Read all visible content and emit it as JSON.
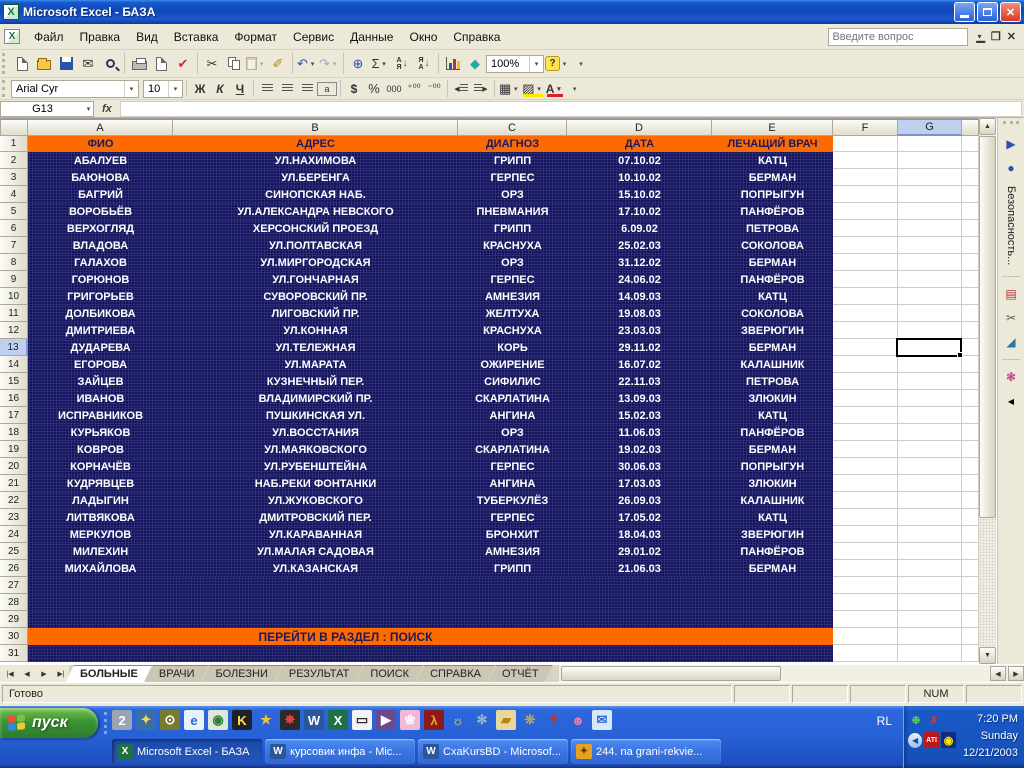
{
  "window": {
    "title": "Microsoft Excel - БАЗА"
  },
  "menu": {
    "items": [
      "Файл",
      "Правка",
      "Вид",
      "Вставка",
      "Формат",
      "Сервис",
      "Данные",
      "Окно",
      "Справка"
    ],
    "question_placeholder": "Введите вопрос"
  },
  "toolbars": {
    "standard": {
      "zoom": "100%"
    },
    "formatting": {
      "font": "Arial Cyr",
      "size": "10",
      "bold": "Ж",
      "italic": "К",
      "underline": "Ч",
      "currency": "$",
      "percent": "%",
      "thousands": "000"
    }
  },
  "formula_bar": {
    "name_box": "G13",
    "fx": "fx"
  },
  "sheet": {
    "columns": [
      "A",
      "B",
      "C",
      "D",
      "E",
      "F",
      "G"
    ],
    "selection": {
      "col": "G",
      "row": 13,
      "cell": "G13"
    },
    "rows_visible": 31,
    "header_row": {
      "cells": [
        "ФИО",
        "АДРЕС",
        "ДИАГНОЗ",
        "ДАТА",
        "ЛЕЧАЩИЙ ВРАЧ"
      ]
    },
    "records": [
      [
        "АБАЛУЕВ",
        "УЛ.НАХИМОВА",
        "ГРИПП",
        "07.10.02",
        "КАТЦ"
      ],
      [
        "БАЮНОВА",
        "УЛ.БЕРЕНГА",
        "ГЕРПЕС",
        "10.10.02",
        "БЕРМАН"
      ],
      [
        "БАГРИЙ",
        "СИНОПСКАЯ НАБ.",
        "ОРЗ",
        "15.10.02",
        "ПОПРЫГУН"
      ],
      [
        "ВОРОБЬЁВ",
        "УЛ.АЛЕКСАНДРА НЕВСКОГО",
        "ПНЕВМАНИЯ",
        "17.10.02",
        "ПАНФЁРОВ"
      ],
      [
        "ВЕРХОГЛЯД",
        "ХЕРСОНСКИЙ ПРОЕЗД",
        "ГРИПП",
        "6.09.02",
        "ПЕТРОВА"
      ],
      [
        "ВЛАДОВА",
        "УЛ.ПОЛТАВСКАЯ",
        "КРАСНУХА",
        "25.02.03",
        "СОКОЛОВА"
      ],
      [
        "ГАЛАХОВ",
        "УЛ.МИРГОРОДСКАЯ",
        "ОРЗ",
        "31.12.02",
        "БЕРМАН"
      ],
      [
        "ГОРЮНОВ",
        "УЛ.ГОНЧАРНАЯ",
        "ГЕРПЕС",
        "24.06.02",
        "ПАНФЁРОВ"
      ],
      [
        "ГРИГОРЬЕВ",
        "СУВОРОВСКИЙ ПР.",
        "АМНЕЗИЯ",
        "14.09.03",
        "КАТЦ"
      ],
      [
        "ДОЛБИКОВА",
        "ЛИГОВСКИЙ ПР.",
        "ЖЕЛТУХА",
        "19.08.03",
        "СОКОЛОВА"
      ],
      [
        "ДМИТРИЕВА",
        "УЛ.КОННАЯ",
        "КРАСНУХА",
        "23.03.03",
        "ЗВЕРЮГИН"
      ],
      [
        "ДУДАРЕВА",
        "УЛ.ТЕЛЕЖНАЯ",
        "КОРЬ",
        "29.11.02",
        "БЕРМАН"
      ],
      [
        "ЕГОРОВА",
        "УЛ.МАРАТА",
        "ОЖИРЕНИЕ",
        "16.07.02",
        "КАЛАШНИК"
      ],
      [
        "ЗАЙЦЕВ",
        "КУЗНЕЧНЫЙ ПЕР.",
        "СИФИЛИС",
        "22.11.03",
        "ПЕТРОВА"
      ],
      [
        "ИВАНОВ",
        "ВЛАДИМИРСКИЙ ПР.",
        "СКАРЛАТИНА",
        "13.09.03",
        "ЗЛЮКИН"
      ],
      [
        "ИСПРАВНИКОВ",
        "ПУШКИНСКАЯ УЛ.",
        "АНГИНА",
        "15.02.03",
        "КАТЦ"
      ],
      [
        "КУРЬЯКОВ",
        "УЛ.ВОССТАНИЯ",
        "ОРЗ",
        "11.06.03",
        "ПАНФЁРОВ"
      ],
      [
        "КОВРОВ",
        "УЛ.МАЯКОВСКОГО",
        "СКАРЛАТИНА",
        "19.02.03",
        "БЕРМАН"
      ],
      [
        "КОРНАЧЁВ",
        "УЛ.РУБЕНШТЕЙНА",
        "ГЕРПЕС",
        "30.06.03",
        "ПОПРЫГУН"
      ],
      [
        "КУДРЯВЦЕВ",
        "НАБ.РЕКИ ФОНТАНКИ",
        "АНГИНА",
        "17.03.03",
        "ЗЛЮКИН"
      ],
      [
        "ЛАДЫГИН",
        "УЛ.ЖУКОВСКОГО",
        "ТУБЕРКУЛЁЗ",
        "26.09.03",
        "КАЛАШНИК"
      ],
      [
        "ЛИТВЯКОВА",
        "ДМИТРОВСКИЙ ПЕР.",
        "ГЕРПЕС",
        "17.05.02",
        "КАТЦ"
      ],
      [
        "МЕРКУЛОВ",
        "УЛ.КАРАВАННАЯ",
        "БРОНХИТ",
        "18.04.03",
        "ЗВЕРЮГИН"
      ],
      [
        "МИЛЕХИН",
        "УЛ.МАЛАЯ САДОВАЯ",
        "АМНЕЗИЯ",
        "29.01.02",
        "ПАНФЁРОВ"
      ],
      [
        "МИХАЙЛОВА",
        "УЛ.КАЗАНСКАЯ",
        "ГРИПП",
        "21.06.03",
        "БЕРМАН"
      ]
    ],
    "banner_row": {
      "row": 30,
      "text": "ПЕРЕЙТИ В РАЗДЕЛ : ПОИСК"
    },
    "colors": {
      "header_bg": "#FF6A00",
      "table_bg": "#15155E",
      "table_text": "#FFFFFF"
    }
  },
  "security_toolbar": {
    "label": "Безопасность..."
  },
  "tabs": {
    "active": "БОЛЬНЫЕ",
    "items": [
      "БОЛЬНЫЕ",
      "ВРАЧИ",
      "БОЛЕЗНИ",
      "РЕЗУЛЬТАТ",
      "ПОИСК",
      "СПРАВКА",
      "ОТЧЁТ"
    ]
  },
  "status_bar": {
    "ready": "Готово",
    "num": "NUM"
  },
  "taskbar": {
    "start": "пуск",
    "quick_launch": [
      {
        "name": "user2-icon",
        "glyph": "2",
        "bg": "#9AA4B2",
        "fg": "#ffffff"
      },
      {
        "name": "winamp-icon",
        "glyph": "✦",
        "bg": "#3A6EA5",
        "fg": "#FFD34D"
      },
      {
        "name": "clock-app-icon",
        "glyph": "⊙",
        "bg": "#7A7A2E",
        "fg": "#ffffff"
      },
      {
        "name": "ie-icon",
        "glyph": "e",
        "bg": "#E8F0FA",
        "fg": "#2A6AD4"
      },
      {
        "name": "reget-icon",
        "glyph": "◉",
        "bg": "#DCE8DC",
        "fg": "#2E7D32"
      },
      {
        "name": "kazaa-icon",
        "glyph": "K",
        "bg": "#20202A",
        "fg": "#FFE34D"
      },
      {
        "name": "star-icon",
        "glyph": "★",
        "bg": "transparent",
        "fg": "#F4C430"
      },
      {
        "name": "nero-icon",
        "glyph": "✸",
        "bg": "#2A2A2A",
        "fg": "#E04040"
      },
      {
        "name": "word-icon",
        "glyph": "W",
        "bg": "#2B579A",
        "fg": "#ffffff"
      },
      {
        "name": "excel-icon",
        "glyph": "X",
        "bg": "#1E7145",
        "fg": "#ffffff"
      },
      {
        "name": "console-icon",
        "glyph": "▭",
        "bg": "#F4F4F4",
        "fg": "#2A2A2A"
      },
      {
        "name": "movie-icon",
        "glyph": "▶",
        "bg": "#6A4A8C",
        "fg": "#ffffff"
      },
      {
        "name": "photo-icon",
        "glyph": "❀",
        "bg": "#F2B8D8",
        "fg": "#ffffff"
      },
      {
        "name": "halflife-icon",
        "glyph": "λ",
        "bg": "#8C1A1A",
        "fg": "#F4A020"
      },
      {
        "name": "bulb-icon",
        "glyph": "☼",
        "bg": "transparent",
        "fg": "#FFE34D"
      },
      {
        "name": "storm-icon",
        "glyph": "✻",
        "bg": "transparent",
        "fg": "#9AB4D0"
      },
      {
        "name": "folder-app-icon",
        "glyph": "▰",
        "bg": "#E8D8A0",
        "fg": "#B8860B"
      },
      {
        "name": "paw-icon",
        "glyph": "❊",
        "bg": "transparent",
        "fg": "#C8B040"
      },
      {
        "name": "red-cross-icon",
        "glyph": "✝",
        "bg": "transparent",
        "fg": "#C03030"
      },
      {
        "name": "people-icon",
        "glyph": "☻",
        "bg": "transparent",
        "fg": "#E87AA0"
      },
      {
        "name": "outlook-icon",
        "glyph": "✉",
        "bg": "#D8E8F8",
        "fg": "#2A6AD4"
      }
    ],
    "buttons": [
      {
        "label": "Microsoft Excel - БАЗА",
        "icon": "excel",
        "active": true
      },
      {
        "label": "курсовик инфа - Mic...",
        "icon": "word",
        "active": false
      },
      {
        "label": "CxaKursBD - Microsof...",
        "icon": "word",
        "active": false
      },
      {
        "label": "244. na grani-rekvie...",
        "icon": "winamp",
        "active": false
      }
    ],
    "tray": {
      "lang": "RL",
      "icons": [
        {
          "name": "agent-icon",
          "glyph": "❉",
          "bg": "transparent",
          "fg": "#58C858"
        },
        {
          "name": "blocked-icon",
          "glyph": "✗",
          "bg": "transparent",
          "fg": "#E03030"
        },
        {
          "name": "ati-icon",
          "glyph": "ATI",
          "bg": "#C01818",
          "fg": "#ffffff"
        },
        {
          "name": "wireless-icon",
          "glyph": "◉",
          "bg": "#102A80",
          "fg": "#FFE000"
        }
      ],
      "time": "7:20 PM",
      "day": "Sunday",
      "date": "12/21/2003"
    }
  }
}
